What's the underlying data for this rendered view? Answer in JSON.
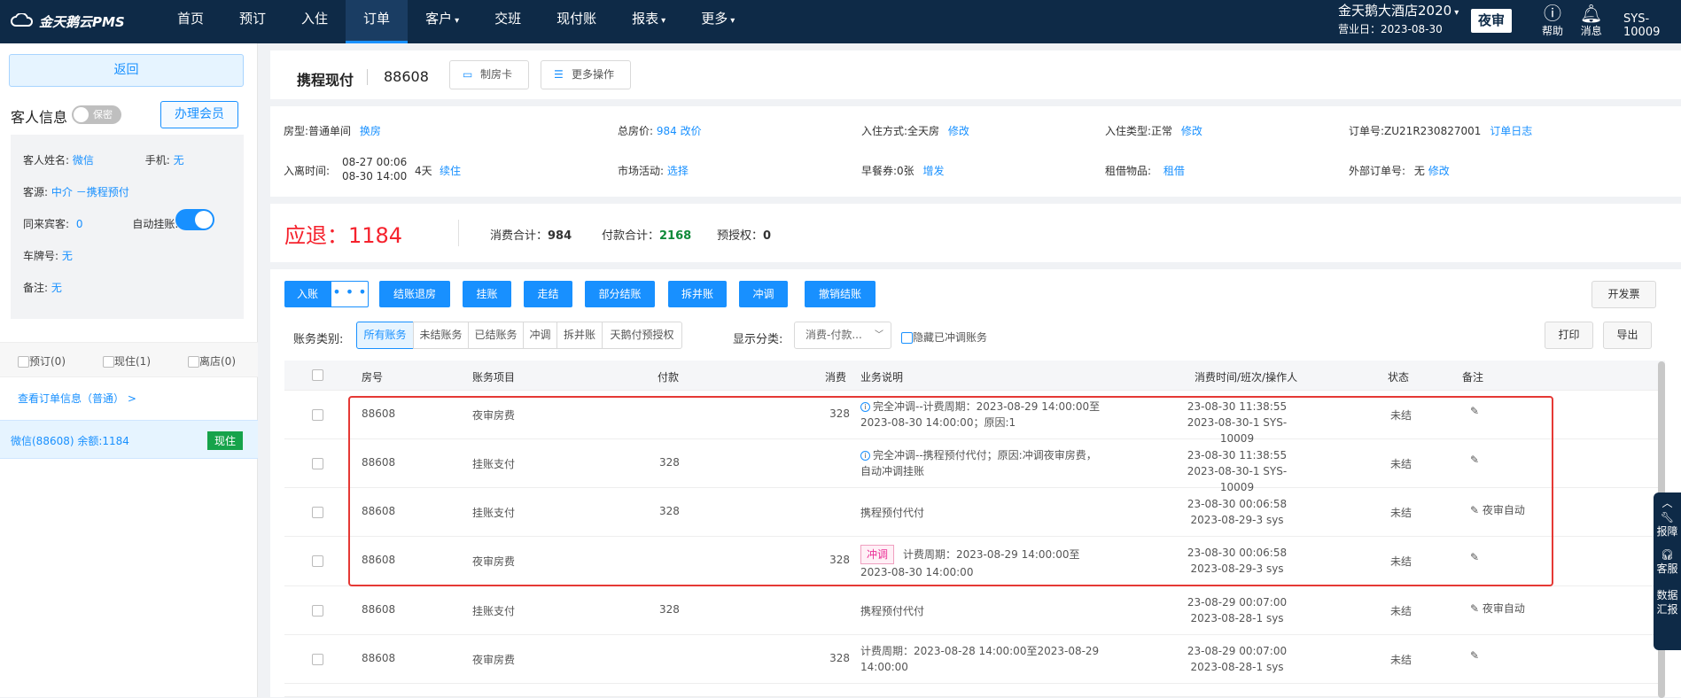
{
  "topbar": {
    "logo": "金天鹅云PMS",
    "nav": [
      {
        "label": "首页",
        "chev": false
      },
      {
        "label": "预订",
        "chev": false
      },
      {
        "label": "入住",
        "chev": false
      },
      {
        "label": "订单",
        "chev": false,
        "active": true
      },
      {
        "label": "客户",
        "chev": true
      },
      {
        "label": "交班",
        "chev": false
      },
      {
        "label": "现付账",
        "chev": false
      },
      {
        "label": "报表",
        "chev": true
      },
      {
        "label": "更多",
        "chev": true
      }
    ],
    "hotel_name": "金天鹅大酒店2020",
    "business_date": "营业日：2023-08-30",
    "night_audit": "夜审",
    "help": "帮助",
    "messages": "消息",
    "user": "SYS-10009"
  },
  "left": {
    "back": "返回",
    "guest_info_title": "客人信息",
    "privacy_label": "保密",
    "member_button": "办理会员",
    "guest_name_label": "客人姓名:",
    "guest_name": "微信",
    "phone_label": "手机:",
    "phone": "无",
    "source_label": "客源:",
    "source": "中介 －携程预付",
    "companions_label": "同来宾客:",
    "companions": "0",
    "auto_hang_label": "自动挂账:",
    "auto_hang_on": true,
    "plate_label": "车牌号:",
    "plate": "无",
    "remark_label": "备注:",
    "remark": "无",
    "status_tabs": [
      "预订(0)",
      "现住(1)",
      "离店(0)"
    ],
    "view_order": "查看订单信息（普通） >",
    "guest_row": "微信(88608)  余额:1184",
    "guest_badge": "现住"
  },
  "header": {
    "title": "携程现付",
    "room_number": "88608",
    "btn_card": "制房卡",
    "btn_more": "更多操作"
  },
  "info": {
    "room_type_label": "房型:",
    "room_type": "普通单间",
    "change_room": "换房",
    "total_price_label": "总房价:",
    "total_price": "984 改价",
    "checkin_mode_label": "入住方式:",
    "checkin_mode": "全天房",
    "modify": "修改",
    "checkin_type_label": "入住类型:",
    "checkin_type": "正常",
    "order_no_label": "订单号:",
    "order_no": "ZU21R230827001",
    "order_log": "订单日志",
    "stay_label": "入离时间:",
    "stay_in": "08-27 00:06",
    "stay_out": "08-30 14:00",
    "stay_days": "4天",
    "extend": "续住",
    "activity_label": "市场活动:",
    "activity": "选择",
    "breakfast_label": "早餐券:",
    "breakfast": "0张",
    "breakfast_add": "增发",
    "rental_label": "租借物品:",
    "rental": "租借",
    "ext_order_label": "外部订单号:",
    "ext_order": "无"
  },
  "totals": {
    "due": "应退：1184",
    "consume_label": "消费合计：",
    "consume": "984",
    "pay_label": "付款合计：",
    "pay": "2168",
    "preauth_label": "预授权：",
    "preauth": "0"
  },
  "actions": {
    "enter": "入账",
    "more": "• • •",
    "buttons": [
      "结账退房",
      "挂账",
      "走结",
      "部分结账",
      "拆并账",
      "冲调",
      "撤销结账"
    ],
    "invoice": "开发票",
    "print": "打印",
    "export": "导出"
  },
  "filters": {
    "category_label": "账务类别:",
    "tabs": [
      "所有账务",
      "未结账务",
      "已结账务",
      "冲调",
      "拆并账",
      "天鹅付预授权"
    ],
    "display_label": "显示分类:",
    "display_value": "消费-付款...",
    "hide_label": "隐藏已冲调账务"
  },
  "table": {
    "headers": [
      "房号",
      "账务项目",
      "付款",
      "消费",
      "业务说明",
      "消费时间/班次/操作人",
      "状态",
      "备注"
    ],
    "rows": [
      {
        "room": "88608",
        "item": "夜审房费",
        "pay": "",
        "consume": "328",
        "desc1": "完全冲调--计费周期：2023-08-29 14:00:00至",
        "desc2": "2023-08-30 14:00:00；原因:1",
        "desc_style": "info",
        "time1": "23-08-30 11:38:55",
        "time2": "2023-08-30-1 SYS-10009",
        "status": "未结",
        "note": "",
        "red": true
      },
      {
        "room": "88608",
        "item": "挂账支付",
        "pay": "328",
        "consume": "",
        "desc1": "完全冲调--携程预付代付；原因:冲调夜审房费，",
        "desc2": "自动冲调挂账",
        "desc_style": "info",
        "time1": "23-08-30 11:38:55",
        "time2": "2023-08-30-1 SYS-10009",
        "status": "未结",
        "note": "",
        "red": true
      },
      {
        "room": "88608",
        "item": "挂账支付",
        "pay": "328",
        "consume": "",
        "desc1": "携程预付代付",
        "desc2": "",
        "desc_style": "plain",
        "time1": "23-08-30 00:06:58",
        "time2": "2023-08-29-3 sys",
        "status": "未结",
        "note": "夜审自动",
        "red": true
      },
      {
        "room": "88608",
        "item": "夜审房费",
        "pay": "",
        "consume": "328",
        "desc_tag": "冲调",
        "desc1": "计费周期：2023-08-29 14:00:00至",
        "desc2": "2023-08-30 14:00:00",
        "desc_style": "tag",
        "time1": "23-08-30 00:06:58",
        "time2": "2023-08-29-3 sys",
        "status": "未结",
        "note": "",
        "red": true
      },
      {
        "room": "88608",
        "item": "挂账支付",
        "pay": "328",
        "consume": "",
        "desc1": "携程预付代付",
        "desc2": "",
        "desc_style": "plain",
        "time1": "23-08-29 00:07:00",
        "time2": "2023-08-28-1 sys",
        "status": "未结",
        "note": "夜审自动",
        "red": false
      },
      {
        "room": "88608",
        "item": "夜审房费",
        "pay": "",
        "consume": "328",
        "desc1": "计费周期：2023-08-28 14:00:00至2023-08-29",
        "desc2": "14:00:00",
        "desc_style": "plain",
        "time1": "23-08-29 00:07:00",
        "time2": "2023-08-28-1 sys",
        "status": "未结",
        "note": "",
        "red": false
      }
    ]
  },
  "dock": {
    "items": [
      "报障",
      "客服",
      "数据汇报"
    ]
  },
  "colors": {
    "primary": "#1890ff",
    "topbar": "#0e2a47",
    "danger": "#f5222d",
    "success": "#0f8a3a"
  }
}
